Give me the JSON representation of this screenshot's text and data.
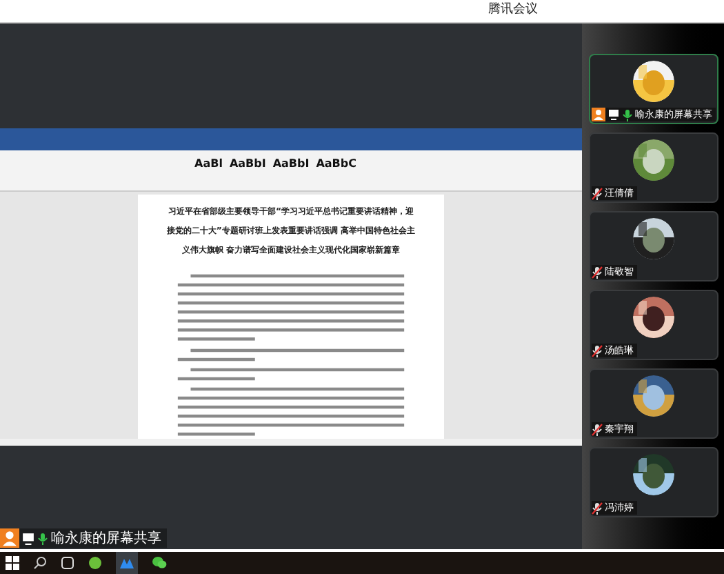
{
  "app_title": "腾讯会议",
  "document": {
    "style_samples": [
      "AaBl",
      "AaBbI",
      "AaBbI",
      "AaBbC"
    ],
    "title_lines": [
      "习近平在省部级主要领导干部“学习习近平总书记重要讲话精神，迎",
      "接党的二十大”专题研讨班上发表重要讲话强调 高举中国特色社会主",
      "义伟大旗帜 奋力谱写全面建设社会主义现代化国家崭新篇章"
    ]
  },
  "participants": [
    {
      "name": "喻永康的屏幕共享",
      "kind": "host",
      "selected": true
    },
    {
      "name": "汪倩倩",
      "kind": "guest",
      "selected": false
    },
    {
      "name": "陆敬智",
      "kind": "guest",
      "selected": false
    },
    {
      "name": "汤皓琳",
      "kind": "guest",
      "selected": false
    },
    {
      "name": "秦宇翔",
      "kind": "guest",
      "selected": false
    },
    {
      "name": "冯沛婷",
      "kind": "guest",
      "selected": false
    }
  ],
  "share_label": "喻永康的屏幕共享"
}
